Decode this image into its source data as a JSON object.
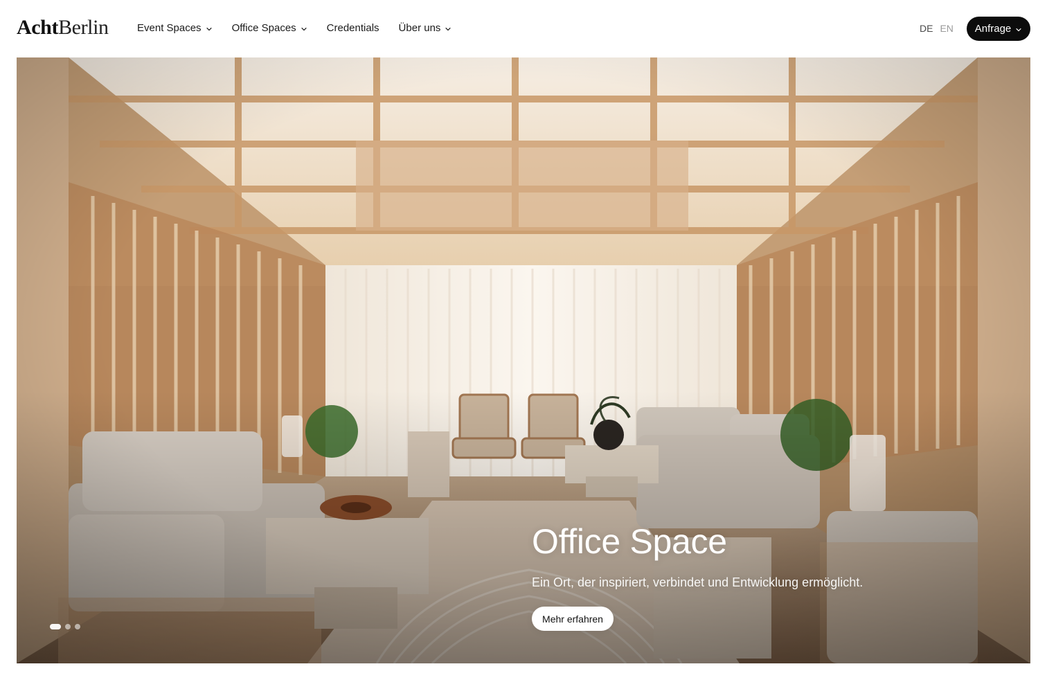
{
  "brand": {
    "logo_bold": "Acht",
    "logo_regular": "Berlin"
  },
  "nav": {
    "items": [
      {
        "label": "Event Spaces",
        "has_dropdown": true,
        "icon": "chevron-down-icon"
      },
      {
        "label": "Office Spaces",
        "has_dropdown": true,
        "icon": "chevron-down-icon"
      },
      {
        "label": "Credentials",
        "has_dropdown": false
      },
      {
        "label": "Über uns",
        "has_dropdown": true,
        "icon": "chevron-down-icon"
      }
    ]
  },
  "language": {
    "active": "DE",
    "inactive": "EN"
  },
  "header_cta": {
    "label": "Anfrage",
    "icon": "chevron-down-icon"
  },
  "hero": {
    "title": "Office Space",
    "subtitle": "Ein Ort, der inspiriert, verbindet und Entwicklung ermöglicht.",
    "button_label": "Mehr erfahren",
    "slides": {
      "current": 1,
      "total": 3
    }
  },
  "colors": {
    "text": "#1b1b1b",
    "cta_bg": "#0c0c0c",
    "hero_wood": "#b58f68",
    "hero_wood_dark": "#8b6646",
    "hero_light": "#f2e6d6",
    "hero_cushion": "#c9beb1"
  }
}
